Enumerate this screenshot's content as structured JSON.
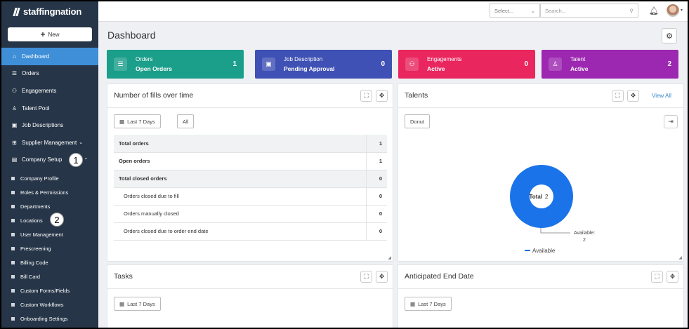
{
  "brand": {
    "name": "staffingnation"
  },
  "sidebar": {
    "new_label": "New",
    "items": [
      {
        "label": "Dashboard",
        "icon": "home-icon"
      },
      {
        "label": "Orders",
        "icon": "orders-icon"
      },
      {
        "label": "Engagements",
        "icon": "engagements-icon"
      },
      {
        "label": "Talent Pool",
        "icon": "person-icon"
      },
      {
        "label": "Job Descriptions",
        "icon": "calendar-icon"
      },
      {
        "label": "Supplier Management",
        "icon": "org-chart-icon"
      },
      {
        "label": "Company Setup",
        "icon": "building-icon"
      }
    ],
    "sub_items": [
      "Company Profile",
      "Roles & Permissions",
      "Departments",
      "Locations",
      "User Management",
      "Prescreening",
      "Billing Code",
      "Bill Card",
      "Custom Forms/Fields",
      "Custom Workflows",
      "Onboarding Settings"
    ],
    "callouts": [
      "1",
      "2"
    ]
  },
  "topbar": {
    "select_placeholder": "Select...",
    "search_placeholder": "Search..."
  },
  "page": {
    "title": "Dashboard"
  },
  "cards": [
    {
      "title": "Orders",
      "subtitle": "Open Orders",
      "count": "1",
      "color": "#1b9e8a"
    },
    {
      "title": "Job Description",
      "subtitle": "Pending Approval",
      "count": "0",
      "color": "#3f51b5"
    },
    {
      "title": "Engagements",
      "subtitle": "Active",
      "count": "0",
      "color": "#e9265e"
    },
    {
      "title": "Talent",
      "subtitle": "Active",
      "count": "2",
      "color": "#9c27b0"
    }
  ],
  "fills_panel": {
    "title": "Number of fills over time",
    "range_label": "Last 7 Days",
    "all_label": "All",
    "rows": [
      {
        "label": "Total orders",
        "value": "1"
      },
      {
        "label": "Open orders",
        "value": "1"
      },
      {
        "label": "Total closed orders",
        "value": "0"
      },
      {
        "label": "Orders closed due to fill",
        "value": "0"
      },
      {
        "label": "Orders manually closed",
        "value": "0"
      },
      {
        "label": "Orders closed due to order end date",
        "value": "0"
      }
    ]
  },
  "talents_panel": {
    "title": "Talents",
    "view_all": "View All",
    "donut_label": "Donut",
    "center_label": "Total",
    "center_value": "2",
    "legend": "Available",
    "callout_label": "Available:",
    "callout_value": "2",
    "color": "#1a73e8"
  },
  "tasks_panel": {
    "title": "Tasks",
    "range_label": "Last 7 Days"
  },
  "end_date_panel": {
    "title": "Anticipated End Date",
    "range_label": "Last 7 Days"
  }
}
